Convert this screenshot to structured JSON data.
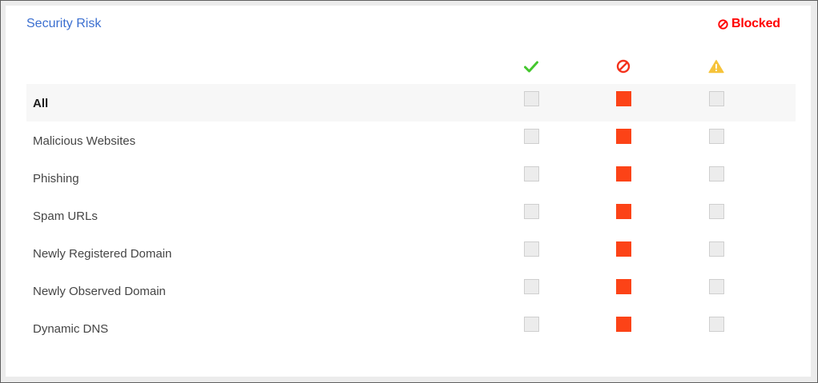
{
  "section": {
    "title": "Security Risk",
    "status_label": "Blocked",
    "status_color": "#ff0000"
  },
  "columns": [
    {
      "icon": "checkmark-icon",
      "meaning": "allow",
      "color": "#44c72e"
    },
    {
      "icon": "block-icon",
      "meaning": "block",
      "color": "#f4311b"
    },
    {
      "icon": "warning-icon",
      "meaning": "warn",
      "color": "#f6c33a"
    }
  ],
  "rows": [
    {
      "label": "All",
      "allow": false,
      "block": true,
      "warn": false
    },
    {
      "label": "Malicious Websites",
      "allow": false,
      "block": true,
      "warn": false
    },
    {
      "label": "Phishing",
      "allow": false,
      "block": true,
      "warn": false
    },
    {
      "label": "Spam URLs",
      "allow": false,
      "block": true,
      "warn": false
    },
    {
      "label": "Newly Registered Domain",
      "allow": false,
      "block": true,
      "warn": false
    },
    {
      "label": "Newly Observed Domain",
      "allow": false,
      "block": true,
      "warn": false
    },
    {
      "label": "Dynamic DNS",
      "allow": false,
      "block": true,
      "warn": false
    }
  ]
}
